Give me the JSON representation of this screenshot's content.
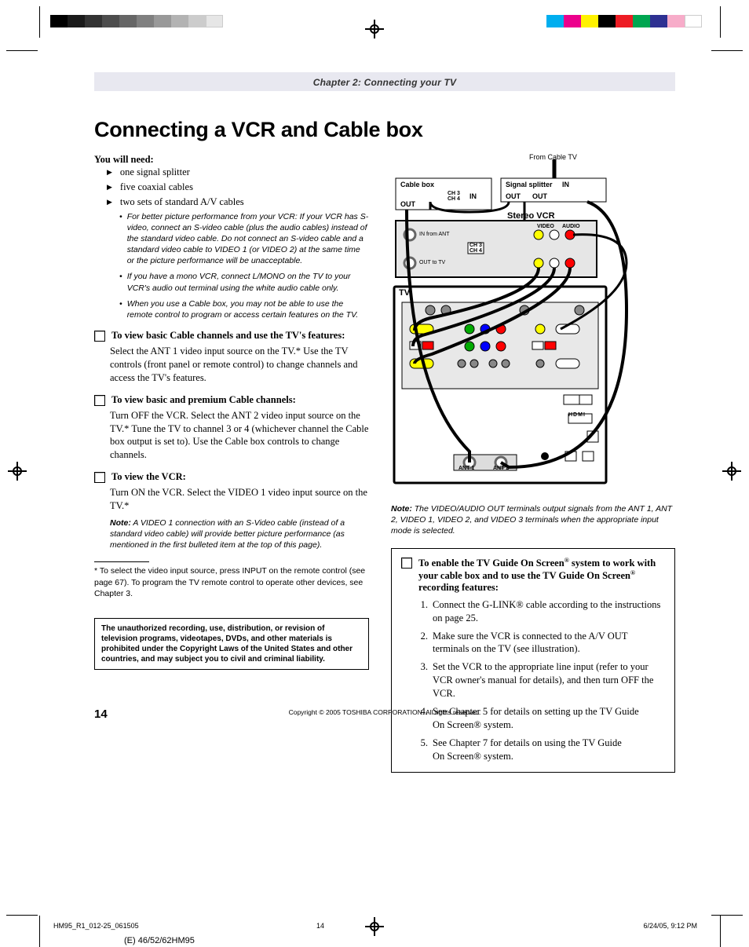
{
  "chapter_header": "Chapter 2: Connecting your TV",
  "main_title": "Connecting a VCR and Cable box",
  "you_will_need": "You will need:",
  "needs": [
    "one signal splitter",
    "five coaxial cables",
    "two sets of standard A/V cables"
  ],
  "tips": [
    "For better picture performance from your VCR: If your VCR has S-video, connect an S-video cable (plus the audio cables) instead of the standard video cable. Do not connect an S-video cable and a standard video cable to VIDEO 1 (or VIDEO 2) at the same time or the picture performance will be unacceptable.",
    "If you have a mono VCR, connect L/MONO on the TV to your VCR's audio out terminal using the white audio cable only.",
    "When you use a Cable box, you may not be able to use the remote control to program or access certain features on the TV."
  ],
  "sections": [
    {
      "title": "To view basic Cable channels and use the TV's features:",
      "body": "Select the ANT 1 video input source on the TV.* Use the TV controls (front panel or remote control) to change channels and access the TV's features."
    },
    {
      "title": "To view basic and premium Cable channels:",
      "body": "Turn OFF the VCR. Select the ANT 2 video input source on the TV.* Tune the TV to channel 3 or 4 (whichever channel the Cable box output is set to). Use the Cable box controls to change channels."
    },
    {
      "title": "To view the VCR:",
      "body": "Turn ON the VCR. Select the VIDEO 1 video input source on the TV.*"
    }
  ],
  "vcr_note_label": "Note:",
  "vcr_note": " A VIDEO 1 connection with an S-Video cable (instead of a standard video cable) will provide better picture performance (as mentioned in the first bulleted item at the top of this page).",
  "footnote": "* To select the video input source, press INPUT on the remote control (see page 67). To program the TV remote control to operate other devices, see Chapter 3.",
  "legal": "The unauthorized recording, use, distribution, or revision of television programs, videotapes, DVDs, and other materials is prohibited under the Copyright Laws of the United States and other countries, and may subject you to civil and criminal liability.",
  "diagram": {
    "from_cable": "From Cable TV",
    "cable_box": "Cable box",
    "signal_splitter": "Signal splitter",
    "in": "IN",
    "out": "OUT",
    "stereo_vcr": "Stereo VCR",
    "in_from_ant": "IN from ANT",
    "out_to_tv": "OUT to TV",
    "tv": "TV",
    "ch3": "CH 3",
    "ch4": "CH 4",
    "video": "VIDEO",
    "audio": "AUDIO",
    "ant1": "ANT 1",
    "ant2": "ANT 2",
    "hdmi": "HDMI"
  },
  "right_note_label": "Note:",
  "right_note": " The VIDEO/AUDIO OUT terminals output signals from the ANT 1, ANT 2, VIDEO 1, VIDEO 2, and VIDEO 3 terminals when the appropriate input mode is selected.",
  "right_box_title_a": "To enable the TV Guide On Screen",
  "right_box_title_b": " system to work with your cable box and to use the TV Guide On Screen",
  "right_box_title_c": " recording features:",
  "right_steps": [
    "Connect the G-LINK® cable according to the instructions on page 25.",
    "Make sure the VCR is connected to the A/V OUT terminals on the TV (see illustration).",
    "Set the VCR to the appropriate line input (refer to your VCR owner's manual for details), and then turn OFF the VCR.",
    "See Chapter 5 for details on setting up the TV Guide On Screen® system.",
    "See Chapter 7 for details on using the TV Guide On Screen® system."
  ],
  "copyright": "Copyright © 2005 TOSHIBA CORPORATION. All rights reserved.",
  "page_number": "14",
  "footer": {
    "left": "HM95_R1_012-25_061505",
    "center": "14",
    "right": "6/24/05, 9:12 PM"
  },
  "model": "(E) 46/52/62HM95",
  "reg": "®"
}
